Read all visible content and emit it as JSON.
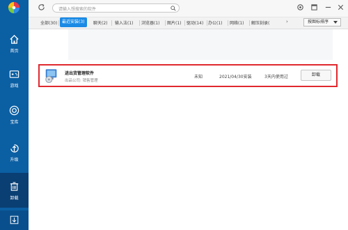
{
  "sidebar": {
    "items": [
      {
        "label": "首页",
        "icon": "home-icon"
      },
      {
        "label": "游戏",
        "icon": "gamepad-icon"
      },
      {
        "label": "宝库",
        "icon": "treasure-icon"
      },
      {
        "label": "升级",
        "icon": "upgrade-icon"
      },
      {
        "label": "卸载",
        "icon": "uninstall-icon"
      }
    ],
    "active_index": 4
  },
  "search": {
    "placeholder": "请输入想搜索的软件"
  },
  "tabs": [
    {
      "label": "全部(30)"
    },
    {
      "label": "最近安装(3)",
      "active": true
    },
    {
      "label": "聊天(2)"
    },
    {
      "label": "输入法(1)"
    },
    {
      "label": "浏览器(1)"
    },
    {
      "label": "图片(1)"
    },
    {
      "label": "驱动(14)"
    },
    {
      "label": "办公(1)"
    },
    {
      "label": "网络(1)"
    },
    {
      "label": "解压刻录("
    }
  ],
  "sort": {
    "label": "按图标排序"
  },
  "software_list": [
    {
      "name": "进出货管理软件",
      "publisher": "出品公司: 销售管理",
      "size": "未知",
      "install_date": "2021/04/30安装",
      "usage": "3天内使用过",
      "action": "卸载"
    }
  ],
  "colors": {
    "sidebar": "#0b5fa3",
    "accent": "#1a8ae5",
    "highlight": "#e0282e"
  }
}
